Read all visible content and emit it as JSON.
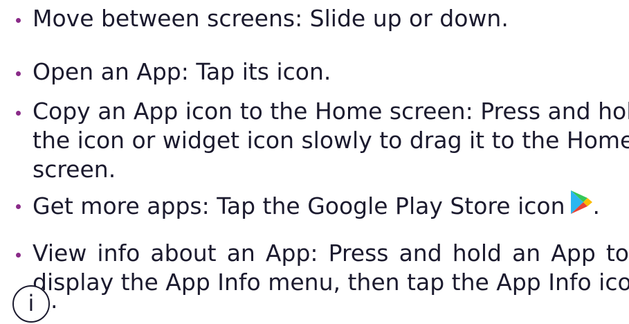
{
  "bullets": [
    {
      "lines": [
        "Move between screens: Slide up or down."
      ]
    },
    {
      "lines": [
        "Open an App: Tap its icon."
      ]
    },
    {
      "lines": [
        "Copy an App icon to the Home screen: Press and hold",
        "the icon or widget icon slowly to drag it to the Home",
        "screen."
      ]
    },
    {
      "lines": [
        "Get more apps: Tap the Google Play Store icon",
        "."
      ]
    },
    {
      "lines": [
        "View info about an App: Press and hold an App to",
        "display the App Info menu, then tap the App Info icon",
        "."
      ]
    }
  ],
  "icons": {
    "play_store": "google-play-store-icon",
    "app_info": "app-info-icon",
    "app_info_glyph": "i"
  },
  "colors": {
    "bullet": "#8a2b88",
    "text": "#1b1a2e"
  }
}
